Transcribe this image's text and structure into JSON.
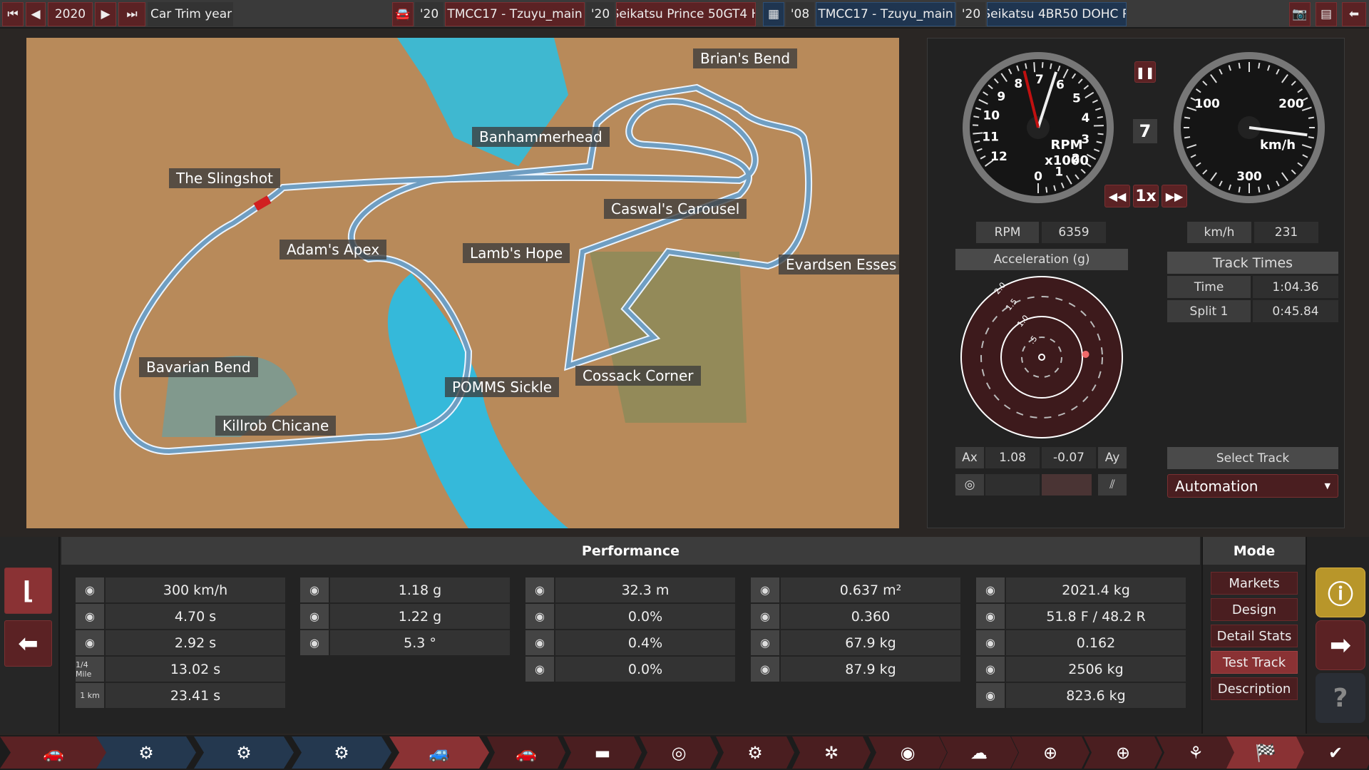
{
  "topbar": {
    "year": "2020",
    "trim_label": "Car Trim year",
    "car1": {
      "year": "'20",
      "model": "TMCC17 - Tzuyu_main",
      "engine_year": "'20",
      "engine": "Seikatsu Prince 50GT4 H"
    },
    "car2": {
      "year": "'08",
      "model": "TMCC17 - Tzuyu_main",
      "engine_year": "'20",
      "engine": "Seikatsu 4BR50 DOHC R"
    }
  },
  "map": {
    "labels": [
      "Brian's Bend",
      "Banhammerhead",
      "The Slingshot",
      "Caswal's Carousel",
      "Adam's Apex",
      "Lamb's Hope",
      "Evardsen Esses",
      "Bavarian Bend",
      "POMMS Sickle",
      "Cossack Corner",
      "Killrob Chicane"
    ]
  },
  "gauges": {
    "rpm_ticks": [
      "0",
      "1",
      "2",
      "3",
      "4",
      "5",
      "6",
      "7",
      "8",
      "9",
      "10",
      "11",
      "12"
    ],
    "rpm_unit": "RPM",
    "rpm_mult": "x1000",
    "speed_ticks": [
      "0",
      "100",
      "200",
      "300"
    ],
    "speed_unit": "km/h",
    "gear": "7",
    "sim_speed": "1x",
    "rpm_needle": 6.359,
    "rpm_redline": 7.6,
    "speed_needle": 231
  },
  "readouts": {
    "rpm_label": "RPM",
    "rpm_value": "6359",
    "speed_label": "km/h",
    "speed_value": "231"
  },
  "accel": {
    "title": "Acceleration (g)",
    "rings": [
      "2.0",
      "1.5",
      "1.0",
      ".5"
    ],
    "ax_label": "Ax",
    "ax": "1.08",
    "ay": "-0.07",
    "ay_label": "Ay",
    "point_color": "#f06a6a"
  },
  "track_times": {
    "title": "Track Times",
    "rows": [
      {
        "label": "Time",
        "value": "1:04.36"
      },
      {
        "label": "Split 1",
        "value": "0:45.84"
      }
    ],
    "select_track": "Select Track",
    "track": "Automation"
  },
  "performance": {
    "title": "Performance",
    "col1": [
      {
        "icon": "top-speed-icon",
        "value": "300 km/h"
      },
      {
        "icon": "0-100-icon",
        "value": "4.70 s"
      },
      {
        "icon": "80-120-icon",
        "value": "2.92 s"
      },
      {
        "icon": "1/4 Mile",
        "value": "13.02 s"
      },
      {
        "icon": "1 km",
        "value": "23.41 s"
      }
    ],
    "col2": [
      {
        "icon": "cornering-icon",
        "value": "1.18 g"
      },
      {
        "icon": "cornering-high-icon",
        "value": "1.22 g"
      },
      {
        "icon": "body-roll-icon",
        "value": "5.3 °"
      }
    ],
    "col3": [
      {
        "icon": "braking-distance-icon",
        "value": "32.3 m"
      },
      {
        "icon": "brake-fade-icon",
        "value": "0.0%"
      },
      {
        "icon": "brake-fade-race-icon",
        "value": "0.4%"
      },
      {
        "icon": "brake-fade-tow-icon",
        "value": "0.0%"
      }
    ],
    "col4": [
      {
        "icon": "frontal-area-icon",
        "value": "0.637 m²"
      },
      {
        "icon": "drag-coefficient-icon",
        "value": "0.360"
      },
      {
        "icon": "front-downforce-icon",
        "value": "67.9 kg"
      },
      {
        "icon": "rear-downforce-icon",
        "value": "87.9 kg"
      }
    ],
    "col5": [
      {
        "icon": "weight-icon",
        "value": "2021.4 kg"
      },
      {
        "icon": "weight-distribution-icon",
        "value": "51.8 F / 48.2 R"
      },
      {
        "icon": "drag-icon",
        "value": "0.162"
      },
      {
        "icon": "towing-icon",
        "value": "2506 kg"
      },
      {
        "icon": "payload-icon",
        "value": "823.6 kg"
      }
    ]
  },
  "mode": {
    "title": "Mode",
    "items": [
      "Markets",
      "Design",
      "Detail Stats",
      "Test Track",
      "Description"
    ],
    "active": "Test Track"
  },
  "colors": {
    "accent_red": "#5b2224",
    "active_red": "#8a3234",
    "blue": "#1f3550",
    "warning": "#b8962a"
  }
}
